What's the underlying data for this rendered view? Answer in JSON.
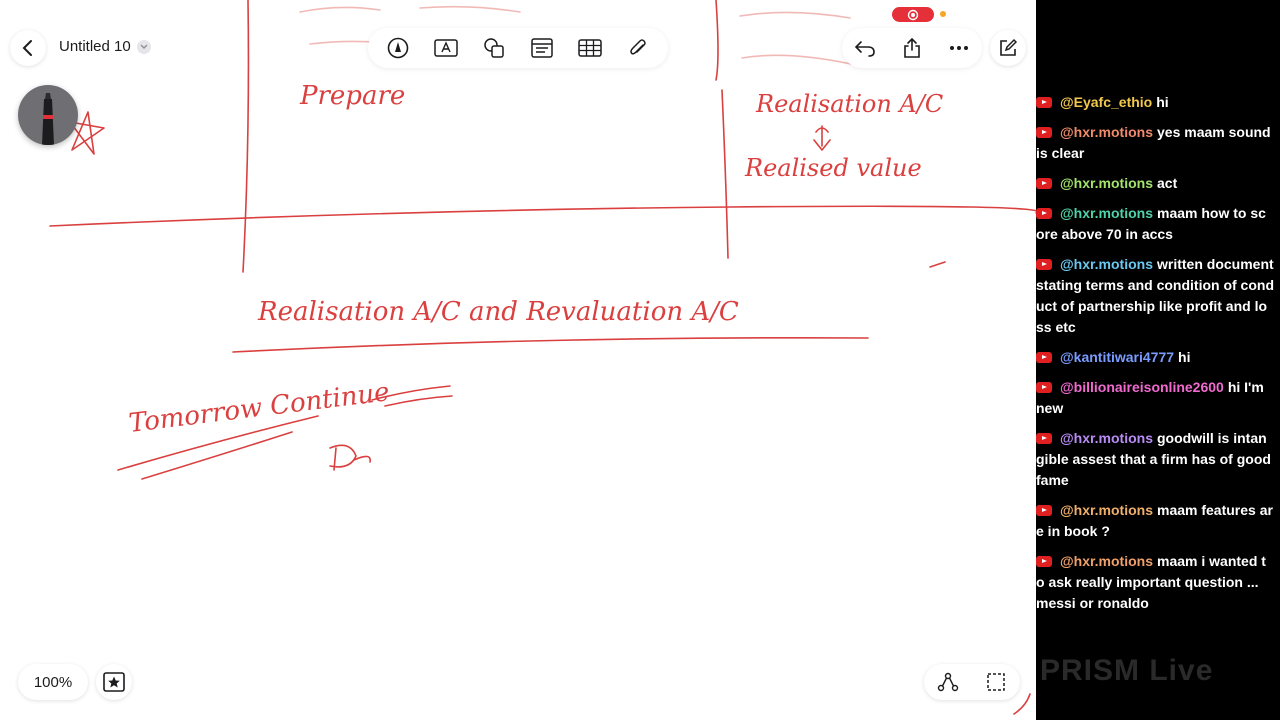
{
  "document": {
    "title": "Untitled 10",
    "zoom": "100%"
  },
  "colors": {
    "ink": "#d9403f",
    "canvas": "#ffffff",
    "chat_bg": "#000000"
  },
  "toolbar": {
    "icons": [
      "pen-tool-icon",
      "text-box-icon",
      "shapes-icon",
      "sticky-note-icon",
      "table-icon",
      "attachment-icon"
    ]
  },
  "right_tools": {
    "icons": [
      "undo-icon",
      "share-icon",
      "more-icon"
    ]
  },
  "handwriting": {
    "top_left": "Prepare",
    "top_right_1": "Realisation A/C",
    "top_right_2": "Realised value",
    "heading": "Realisation A/C and Revaluation A/C",
    "bottom_left": "Tomorrow Continue"
  },
  "chat": {
    "messages": [
      {
        "user": "@Eyafc_ethio",
        "color": "#f2c94c",
        "text": "hi"
      },
      {
        "user": "@hxr.motions",
        "color": "#f08a6a",
        "text": "yes maam sound is clear"
      },
      {
        "user": "@hxr.motions",
        "color": "#a3e36b",
        "text": "act"
      },
      {
        "user": "@hxr.motions",
        "color": "#4fd2a8",
        "text": "maam how to score above 70 in accs"
      },
      {
        "user": "@hxr.motions",
        "color": "#6ac8f0",
        "text": "written document stating terms and condition of conduct of partnership like profit and loss etc"
      },
      {
        "user": "@kantitiwari4777",
        "color": "#7a9cff",
        "text": "hi"
      },
      {
        "user": "@billionaireisonline2600",
        "color": "#f06ad0",
        "text": "hi I'm new"
      },
      {
        "user": "@hxr.motions",
        "color": "#b98cf5",
        "text": "goodwill is intangible assest that a firm has of good fame"
      },
      {
        "user": "@hxr.motions",
        "color": "#f0b06a",
        "text": "maam features are in book ?"
      },
      {
        "user": "@hxr.motions",
        "color": "#f0a06a",
        "text": "maam i wanted to ask really important question ... messi or ronaldo"
      }
    ]
  },
  "watermark": "PRISM Live"
}
